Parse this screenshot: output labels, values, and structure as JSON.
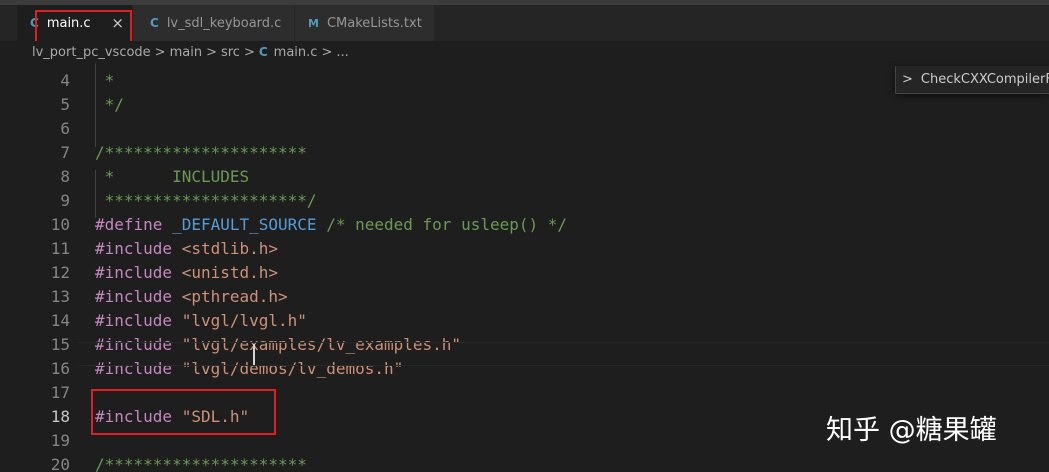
{
  "tabs": [
    {
      "icon": "C",
      "label": "main.c",
      "active": true,
      "close": "×"
    },
    {
      "icon": "C",
      "label": "lv_sdl_keyboard.c",
      "active": false
    },
    {
      "icon": "M",
      "label": "CMakeLists.txt",
      "active": false
    }
  ],
  "breadcrumb": {
    "items": [
      "lv_port_pc_vscode",
      "main",
      "src",
      "main.c",
      "..."
    ],
    "separator": ">",
    "file_icon": "C"
  },
  "find_panel": {
    "chevron": ">",
    "text": "CheckCXXCompilerFlag"
  },
  "editor": {
    "line_numbers": [
      "4",
      "5",
      "6",
      "7",
      "8",
      "9",
      "10",
      "11",
      "12",
      "13",
      "14",
      "15",
      "16",
      "17",
      "18",
      "19",
      "20"
    ],
    "lines": [
      [
        {
          "t": " *",
          "c": "cm"
        }
      ],
      [
        {
          "t": " */",
          "c": "cm"
        }
      ],
      [],
      [
        {
          "t": "/*********************",
          "c": "cm"
        }
      ],
      [
        {
          "t": " *      INCLUDES",
          "c": "cm"
        }
      ],
      [
        {
          "t": " *********************/",
          "c": "cm"
        }
      ],
      [
        {
          "t": "#define ",
          "c": "kw"
        },
        {
          "t": "_DEFAULT_SOURCE",
          "c": "mac"
        },
        {
          "t": " ",
          "c": ""
        },
        {
          "t": "/* needed for usleep() */",
          "c": "cm"
        }
      ],
      [
        {
          "t": "#include ",
          "c": "kw"
        },
        {
          "t": "<stdlib.h>",
          "c": "str"
        }
      ],
      [
        {
          "t": "#include ",
          "c": "kw"
        },
        {
          "t": "<unistd.h>",
          "c": "str"
        }
      ],
      [
        {
          "t": "#include ",
          "c": "kw"
        },
        {
          "t": "<pthread.h>",
          "c": "str"
        }
      ],
      [
        {
          "t": "#include ",
          "c": "kw"
        },
        {
          "t": "\"lvgl/lvgl.h\"",
          "c": "str"
        }
      ],
      [
        {
          "t": "#include ",
          "c": "kw"
        },
        {
          "t": "\"lvgl/examples/lv_examples.h\"",
          "c": "str"
        }
      ],
      [
        {
          "t": "#include ",
          "c": "kw"
        },
        {
          "t": "\"lvgl/demos/lv_demos.h\"",
          "c": "str"
        }
      ],
      [],
      [
        {
          "t": "#include ",
          "c": "kw"
        },
        {
          "t": "\"SDL.h\"",
          "c": "str"
        }
      ],
      [],
      [
        {
          "t": "/*********************",
          "c": "cm"
        }
      ]
    ]
  },
  "watermark": "知乎 @糖果罐",
  "colors": {
    "highlight_box": "#e02020",
    "comment": "#6a9955",
    "keyword": "#c586c0",
    "string": "#ce9178",
    "macro": "#569cd6"
  }
}
